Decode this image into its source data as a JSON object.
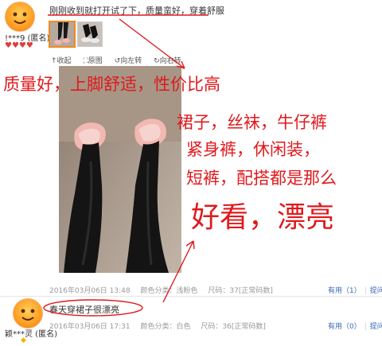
{
  "review1": {
    "text": "刚刚收到就打开试了下，质量蛮好，穿着舒服",
    "user": "!***9 (匿名)",
    "rating_hearts": "♥♥♥♥",
    "tools": [
      "收起",
      "原图",
      "向左转",
      "向右转"
    ],
    "date": "2016年03月06日 13:48",
    "color": "颜色分类：浅粉色",
    "size": "尺码：37[正常码数]",
    "useful": "有用（1）",
    "reply": "提问"
  },
  "review2": {
    "text": "春天穿裙子很漂亮",
    "user": "颖***灵 (匿名)",
    "badge": "◆",
    "date": "2016年03月06日 17:31",
    "color": "颜色分类：白色",
    "size": "尺码：36[正常码数]",
    "useful": "有用（0）",
    "reply": "提问"
  },
  "annotations": {
    "a1": "质量好，上脚舒适，性价比高",
    "a2": "裙子，丝袜，牛仔裤",
    "a3": "紧身裤，休闲装，",
    "a4": "短裤，配搭都是那么",
    "a5": "好看，漂亮"
  },
  "colors": {
    "annotation": "#e0191d",
    "link": "#3a67b5",
    "selected_thumb": "#f28a1e"
  }
}
